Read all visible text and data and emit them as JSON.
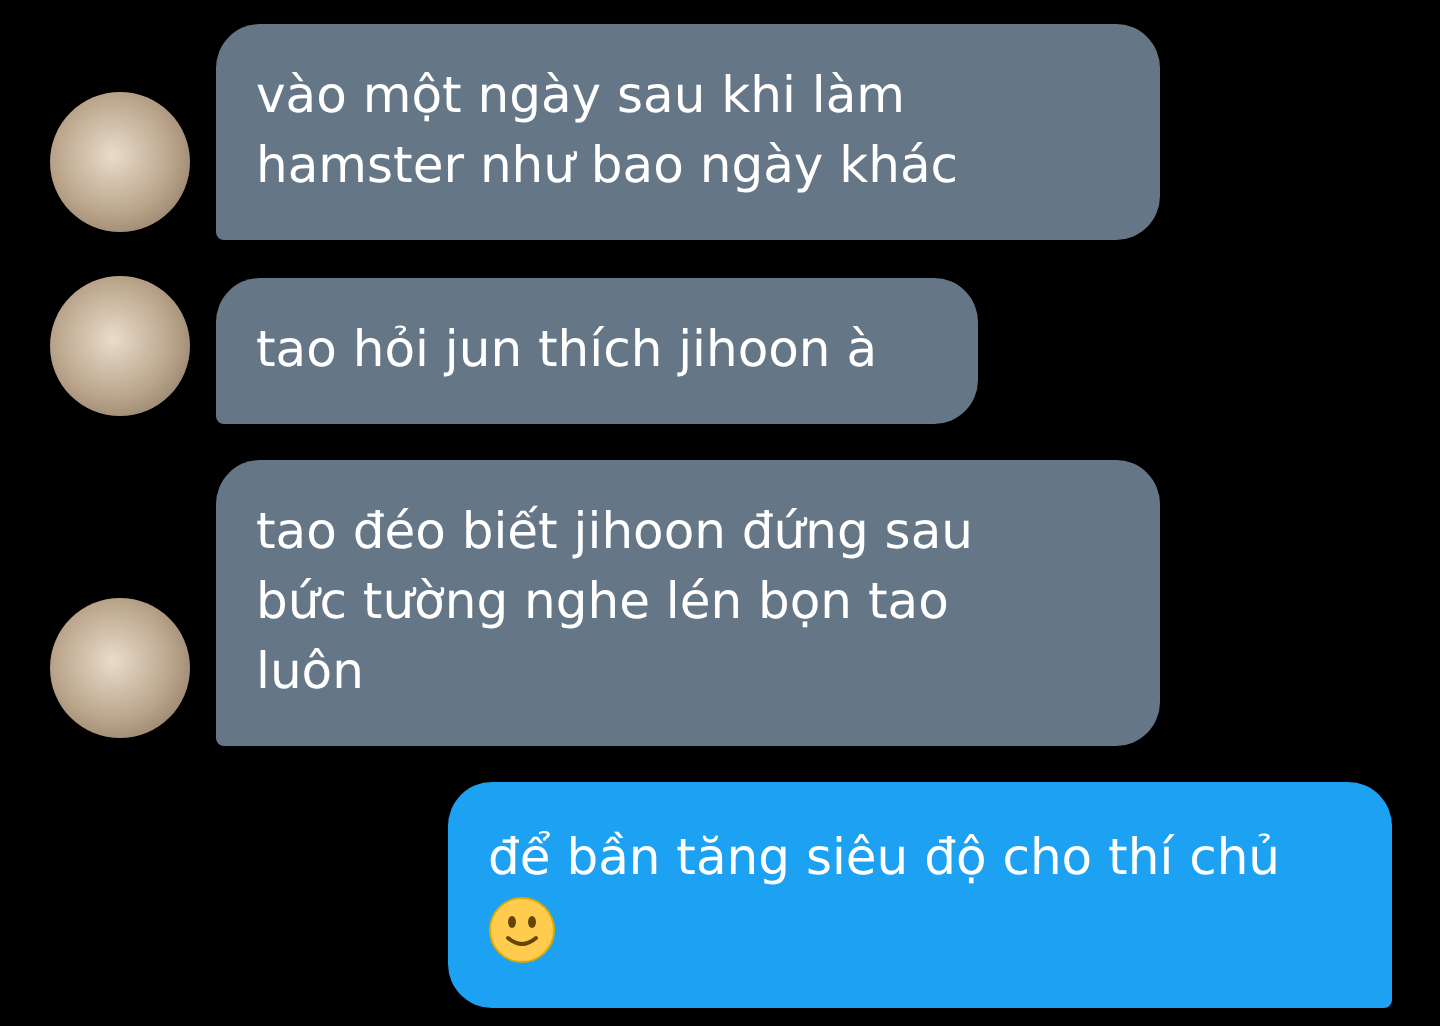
{
  "messages": [
    {
      "kind": "received",
      "text": "vào một ngày sau khi làm hamster như bao ngày khác"
    },
    {
      "kind": "received",
      "text": "tao hỏi jun thích jihoon à"
    },
    {
      "kind": "received",
      "text": "tao đéo biết jihoon đứng sau bức tường nghe lén bọn tao luôn"
    },
    {
      "kind": "sent",
      "text": "để bần tăng siêu độ cho thí chủ",
      "smiley": true
    }
  ]
}
